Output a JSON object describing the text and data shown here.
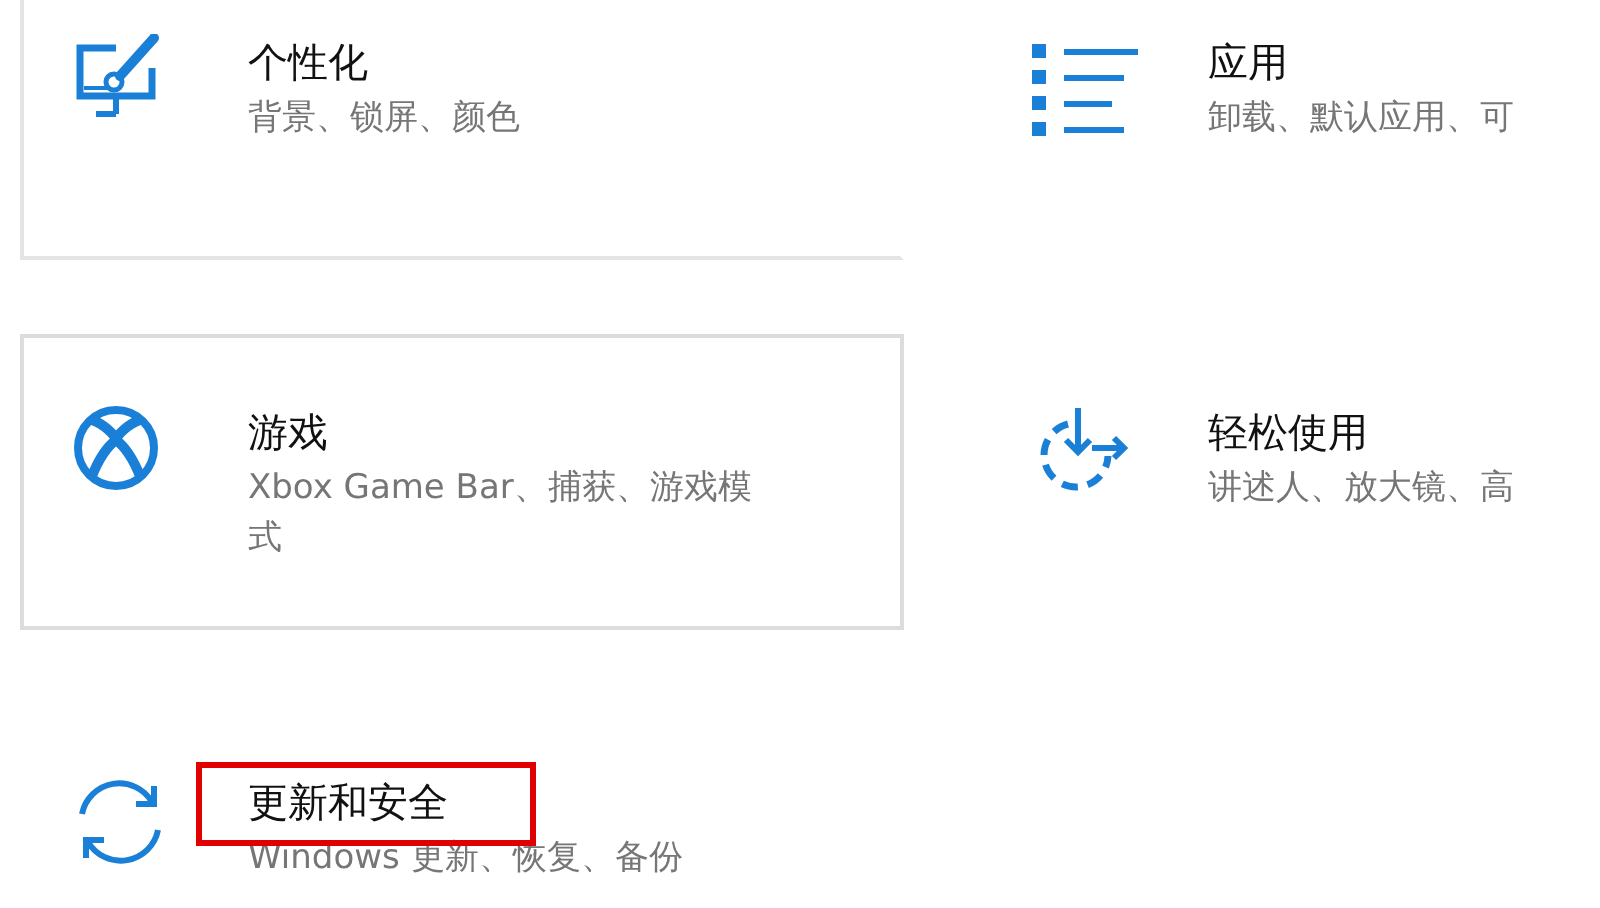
{
  "tiles": [
    {
      "kind": "personalization",
      "title": "个性化",
      "subtitle": "背景、锁屏、颜色",
      "hovered": false,
      "edge_glow": true,
      "marked": false
    },
    {
      "kind": "apps",
      "title": "应用",
      "subtitle": "卸载、默认应用、可",
      "hovered": false,
      "edge_glow": false,
      "marked": false
    },
    {
      "kind": "gaming",
      "title": "游戏",
      "subtitle": "Xbox Game Bar、捕获、游戏模式",
      "hovered": true,
      "edge_glow": false,
      "marked": false
    },
    {
      "kind": "ease",
      "title": "轻松使用",
      "subtitle": "讲述人、放大镜、高",
      "hovered": false,
      "edge_glow": false,
      "marked": false
    },
    {
      "kind": "update",
      "title": "更新和安全",
      "subtitle": "Windows 更新、恢复、备份",
      "hovered": false,
      "edge_glow": false,
      "marked": true
    }
  ]
}
